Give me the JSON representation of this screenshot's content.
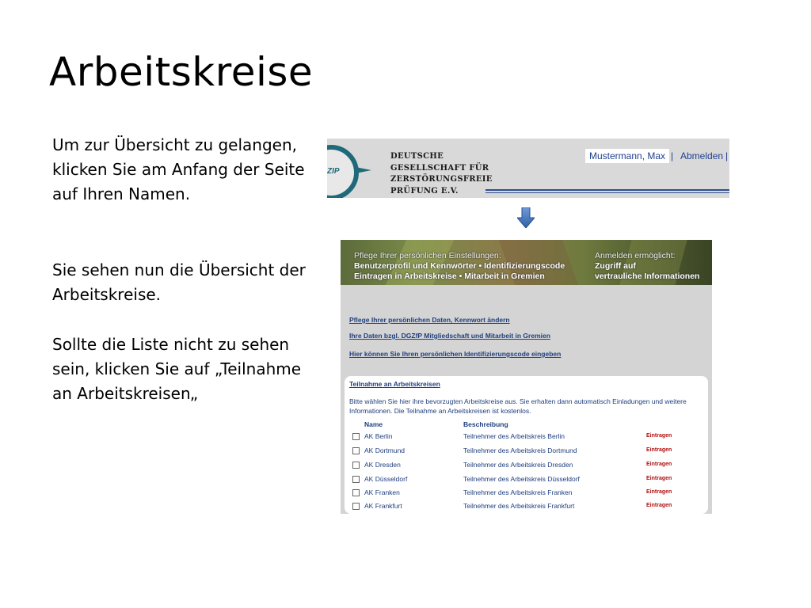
{
  "slide": {
    "title": "Arbeitskreise",
    "text1": "Um zur Übersicht zu gelangen, klicken Sie am Anfang der Seite auf Ihren Namen.",
    "text2": "Sie sehen nun die Übersicht der Arbeitskreise.",
    "text3": "Sollte die Liste nicht zu sehen sein, klicken Sie auf „Teilnahme an Arbeitskreisen„"
  },
  "header": {
    "logo_text": "ZIP",
    "org_lines": [
      "Deutsche",
      "Gesellschaft für",
      "Zerstörungsfreie",
      "Prüfung e.V."
    ],
    "user_name": "Mustermann, Max",
    "separator": "|",
    "logout": "Abmelden",
    "separator_end": "|",
    "accent_color": "#1f6a7a"
  },
  "banner": {
    "left_small": "Pflege Ihrer persönlichen Einstellungen:",
    "left_line1": "Benutzerprofil und Kennwörter • Identifizierungscode",
    "left_line2": "Eintragen in Arbeitskreise • Mitarbeit in Gremien",
    "right_small": "Anmelden ermöglicht:",
    "right_line1": "Zugriff auf",
    "right_line2": "vertrauliche Informationen"
  },
  "links": {
    "personal_data": "Pflege Ihrer persönlichen Daten, Kennwort ändern",
    "membership": "Ihre Daten bzgl. DGZfP Mitgliedschaft und Mitarbeit in Gremien",
    "id_code": "Hier können Sie Ihren persönlichen Identifizierungscode eingeben"
  },
  "panel": {
    "title": "Teilnahme an Arbeitskreisen",
    "description": "Bitte wählen Sie hier ihre bevorzugten Arbeitskreise aus. Sie erhalten dann automatisch Einladungen und weitere Informationen. Die Teilnahme an Arbeitskreisen ist kostenlos.",
    "col_name": "Name",
    "col_desc": "Beschreibung",
    "rows": [
      {
        "name": "AK Berlin",
        "desc": "Teilnehmer des Arbeitskreis Berlin",
        "action": "Eintragen"
      },
      {
        "name": "AK Dortmund",
        "desc": "Teilnehmer des Arbeitskreis Dortmund",
        "action": "Eintragen"
      },
      {
        "name": "AK Dresden",
        "desc": "Teilnehmer des Arbeitskreis Dresden",
        "action": "Eintragen"
      },
      {
        "name": "AK Düsseldorf",
        "desc": "Teilnehmer des Arbeitskreis Düsseldorf",
        "action": "Eintragen"
      },
      {
        "name": "AK Franken",
        "desc": "Teilnehmer des Arbeitskreis Franken",
        "action": "Eintragen"
      },
      {
        "name": "AK Frankfurt",
        "desc": "Teilnehmer des Arbeitskreis Frankfurt",
        "action": "Eintragen"
      }
    ]
  }
}
